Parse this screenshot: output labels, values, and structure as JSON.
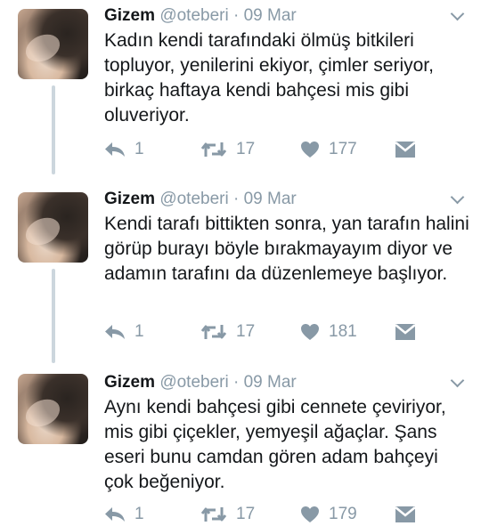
{
  "tweets": [
    {
      "name": "Gizem",
      "handle": "@oteberi",
      "separator": "·",
      "date": "09 Mar",
      "text": "Kadın kendi tarafındaki ölmüş bitkileri topluyor, yenilerini ekiyor, çimler seriyor, birkaç haftaya kendi bahçesi mis gibi oluveriyor.",
      "replies": "1",
      "retweets": "17",
      "likes": "177"
    },
    {
      "name": "Gizem",
      "handle": "@oteberi",
      "separator": "·",
      "date": "09 Mar",
      "text": "Kendi tarafı bittikten sonra, yan tarafın halini görüp burayı böyle bırakmayayım diyor ve adamın tarafını da düzenlemeye başlıyor.",
      "replies": "1",
      "retweets": "17",
      "likes": "181"
    },
    {
      "name": "Gizem",
      "handle": "@oteberi",
      "separator": "·",
      "date": "09 Mar",
      "text": "Aynı kendi bahçesi gibi cennete çeviriyor, mis gibi çiçekler, yemyeşil ağaçlar. Şans eseri bunu camdan gören adam bahçeyi çok beğeniyor.",
      "replies": "1",
      "retweets": "17",
      "likes": "179"
    }
  ],
  "icons": {
    "reply": "reply-icon",
    "retweet": "retweet-icon",
    "like": "heart-icon",
    "message": "direct-message-icon",
    "more": "chevron-down-icon"
  },
  "colors": {
    "text": "#14171a",
    "muted": "#8899a6",
    "thread_line": "#ccd6dd"
  }
}
